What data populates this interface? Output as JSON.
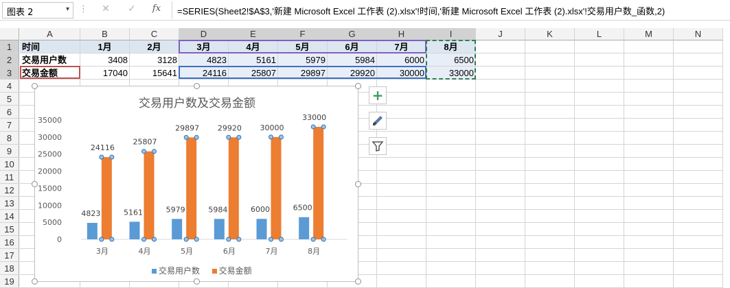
{
  "namebox": {
    "value": "图表 2",
    "dropdown": "▾"
  },
  "formula_bar": {
    "more": "⋮",
    "cancel": "✕",
    "enter": "✓",
    "fx": "fx",
    "formula": "=SERIES(Sheet2!$A$3,'新建 Microsoft Excel 工作表 (2).xlsx'!时间,'新建 Microsoft Excel 工作表 (2).xlsx'!交易用户数_函数,2)"
  },
  "columns": [
    "A",
    "B",
    "C",
    "D",
    "E",
    "F",
    "G",
    "H",
    "I",
    "J",
    "K",
    "L",
    "M",
    "N"
  ],
  "rows": [
    "1",
    "2",
    "3",
    "4",
    "5",
    "6",
    "7",
    "8",
    "9",
    "10",
    "11",
    "12",
    "13",
    "14",
    "15",
    "16",
    "17",
    "18",
    "19"
  ],
  "table": {
    "header": [
      "时间",
      "1月",
      "2月",
      "3月",
      "4月",
      "5月",
      "6月",
      "7月",
      "8月"
    ],
    "rows": [
      [
        "交易用户数",
        "3408",
        "3128",
        "4823",
        "5161",
        "5979",
        "5984",
        "6000",
        "6500"
      ],
      [
        "交易金额",
        "17040",
        "15641",
        "24116",
        "25807",
        "29897",
        "29920",
        "30000",
        "33000"
      ]
    ]
  },
  "chart_actions": {
    "add_element": "+",
    "styles": "brush-icon",
    "filter": "filter-icon"
  },
  "chart_data": {
    "type": "bar",
    "title": "交易用户数及交易金额",
    "categories": [
      "3月",
      "4月",
      "5月",
      "6月",
      "7月",
      "8月"
    ],
    "series": [
      {
        "name": "交易用户数",
        "values": [
          4823,
          5161,
          5979,
          5984,
          6000,
          6500
        ],
        "color": "#5b9bd5"
      },
      {
        "name": "交易金额",
        "values": [
          24116,
          25807,
          29897,
          29920,
          30000,
          33000
        ],
        "color": "#ed7d31"
      }
    ],
    "yticks": [
      "0",
      "5000",
      "10000",
      "15000",
      "20000",
      "25000",
      "30000",
      "35000"
    ],
    "ylim": [
      0,
      35000
    ],
    "legend": "bottom",
    "data_labels": true,
    "grid": false
  }
}
